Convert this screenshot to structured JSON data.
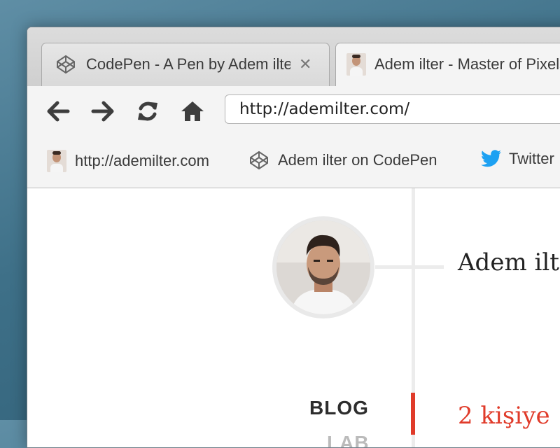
{
  "tabs": [
    {
      "label": "CodePen - A Pen by Adem ilter",
      "icon": "codepen-icon",
      "close": "✕"
    },
    {
      "label": "Adem ilter - Master of Pixels",
      "icon": "avatar-favicon"
    }
  ],
  "toolbar": {
    "back": "←",
    "forward": "→",
    "reload": "⟳",
    "home": "⌂",
    "url": "http://ademilter.com/"
  },
  "bookmarks": [
    {
      "label": "http://ademilter.com",
      "icon": "avatar-favicon"
    },
    {
      "label": "Adem ilter on CodePen",
      "icon": "codepen-icon"
    },
    {
      "label": "Twitter",
      "icon": "twitter-icon"
    }
  ],
  "page": {
    "name": "Adem ilter",
    "menu": [
      "BLOG",
      "LAB"
    ],
    "post_title": "2 kişiye"
  },
  "colors": {
    "accent": "#e03b2a",
    "twitter": "#1da1f2"
  }
}
